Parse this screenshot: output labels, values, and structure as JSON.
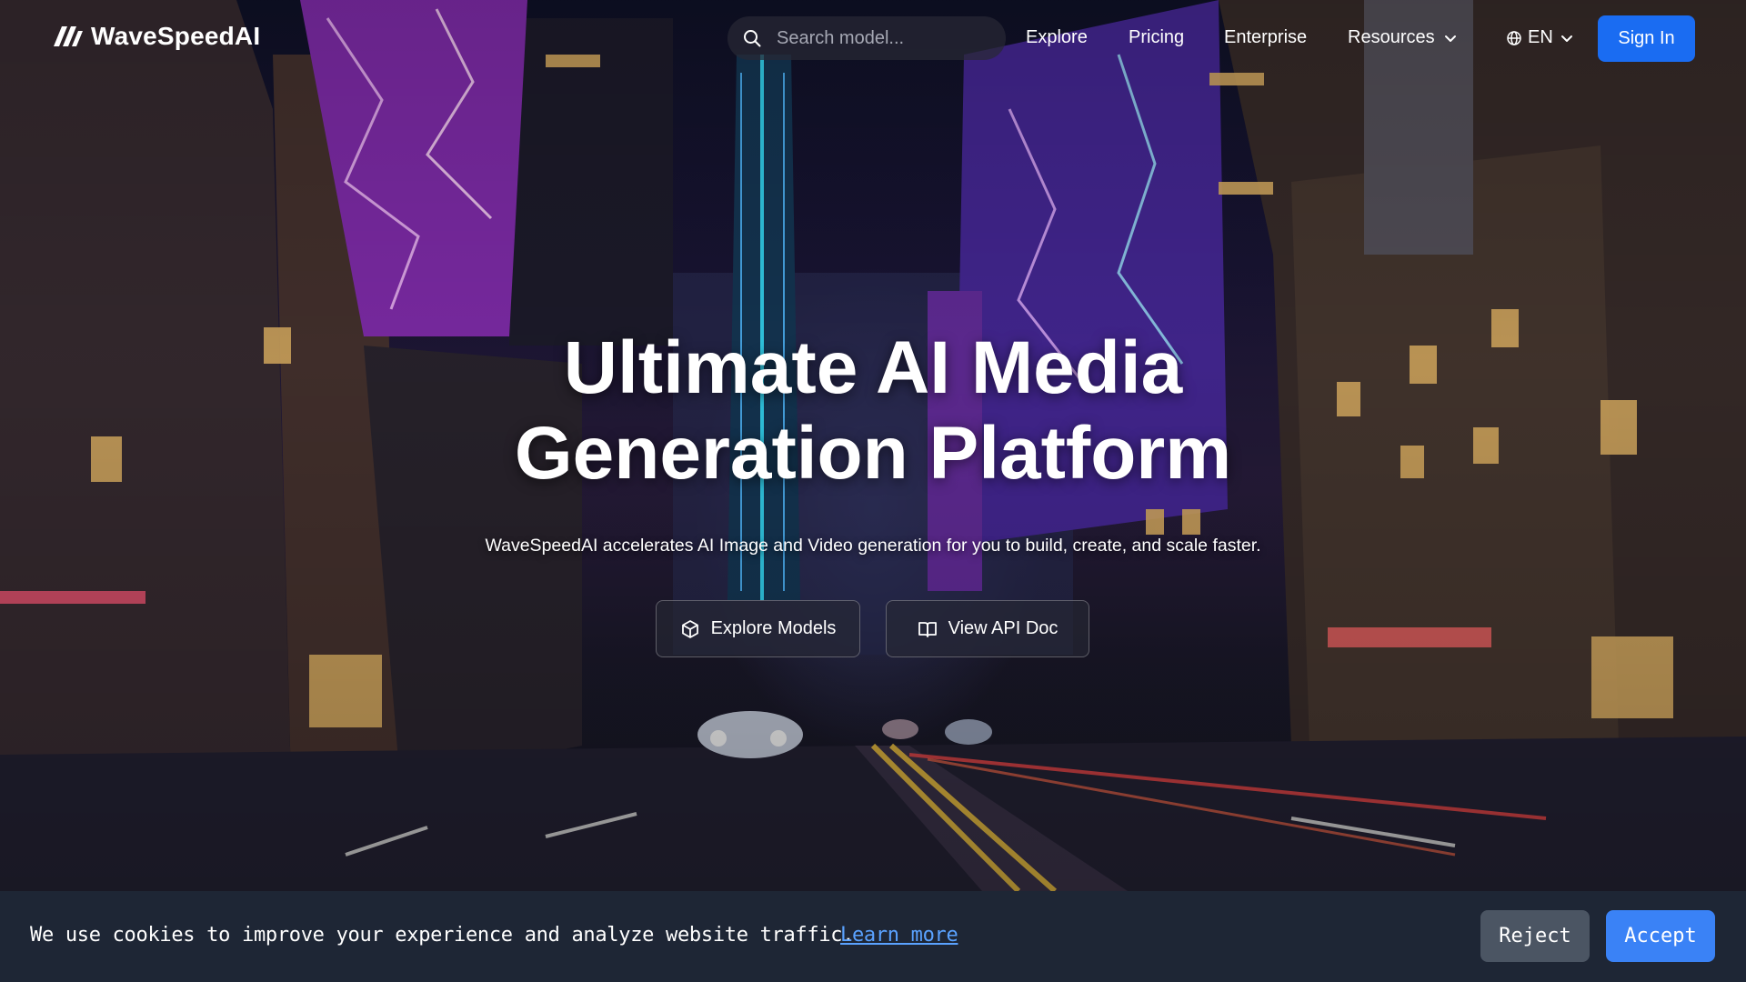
{
  "brand": {
    "name": "WaveSpeedAI",
    "logo_icon": "wave-slash-logo"
  },
  "nav": {
    "search_placeholder": "Search model...",
    "links": [
      "Explore",
      "Pricing",
      "Enterprise"
    ],
    "resources_label": "Resources",
    "language_label": "EN",
    "signin_label": "Sign In"
  },
  "hero": {
    "title_line1": "Ultimate AI Media",
    "title_line2": "Generation Platform",
    "subtitle": "WaveSpeedAI accelerates AI Image and Video generation for you to build, create, and scale faster.",
    "buttons": [
      {
        "label": "Explore Models",
        "icon": "cube-icon"
      },
      {
        "label": "View API Doc",
        "icon": "book-open-icon"
      }
    ],
    "background": "night-city-street-neon"
  },
  "cookie_banner": {
    "text": "We use cookies to improve your experience and analyze website traffic.",
    "link_label": "Learn more",
    "reject_label": "Reject",
    "accept_label": "Accept"
  },
  "colors": {
    "primary_button": "#1a6cf2",
    "accept_button": "#3a82f6",
    "reject_button": "#4b5563",
    "cookie_banner_bg": "#1e2635",
    "link": "#5aa2ff"
  }
}
